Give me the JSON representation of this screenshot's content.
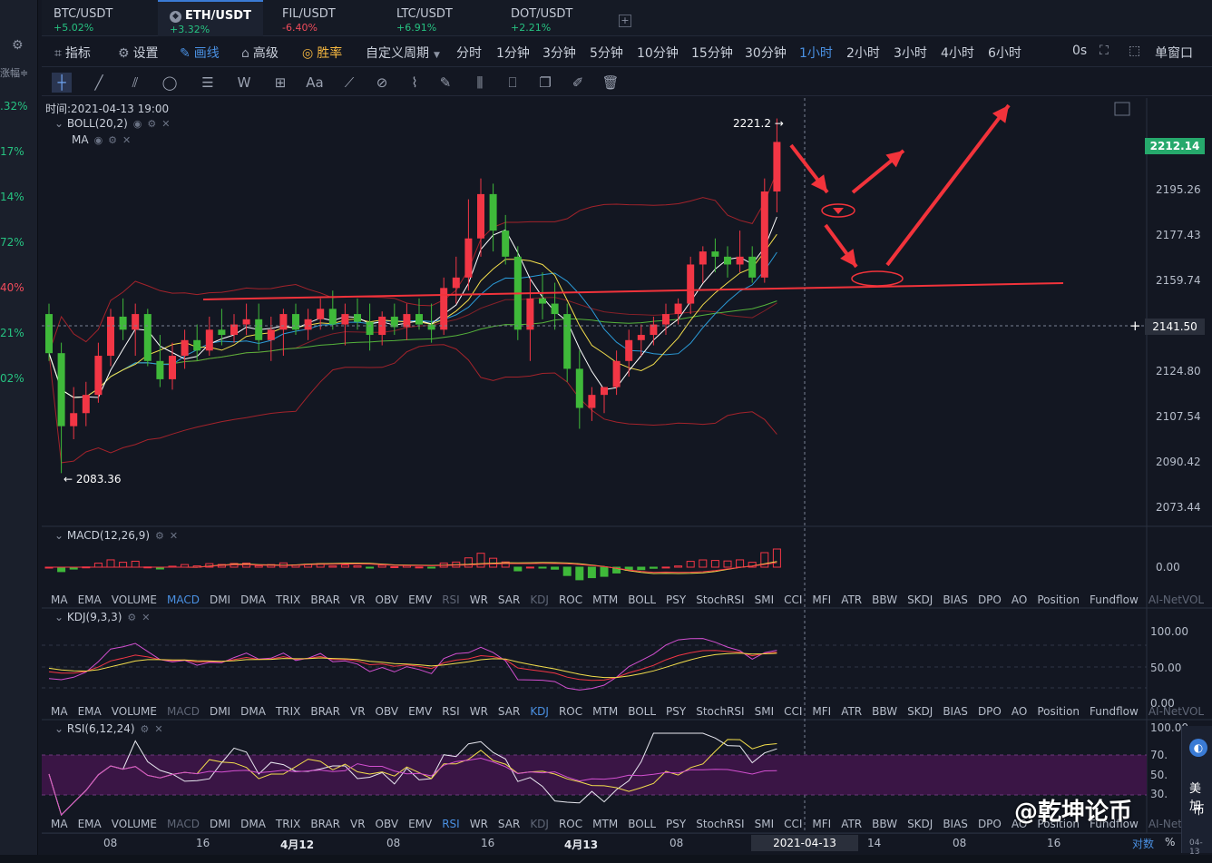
{
  "tabs": [
    {
      "symbol": "BTC/USDT",
      "change": "+5.02%",
      "color": "#26c281"
    },
    {
      "symbol": "ETH/USDT",
      "change": "+3.32%",
      "color": "#26c281"
    },
    {
      "symbol": "FIL/USDT",
      "change": "-6.40%",
      "color": "#f04b5b"
    },
    {
      "symbol": "LTC/USDT",
      "change": "+6.91%",
      "color": "#26c281"
    },
    {
      "symbol": "DOT/USDT",
      "change": "+2.21%",
      "color": "#26c281"
    }
  ],
  "add_tab": "+",
  "left_column": {
    "header": "涨幅≑",
    "items": [
      {
        "text": ".32%",
        "color": "#26c281"
      },
      {
        "text": "17%",
        "color": "#26c281"
      },
      {
        "text": "14%",
        "color": "#26c281"
      },
      {
        "text": "72%",
        "color": "#26c281"
      },
      {
        "text": "40%",
        "color": "#f04b5b"
      },
      {
        "text": "21%",
        "color": "#26c281"
      },
      {
        "text": "02%",
        "color": "#26c281"
      }
    ]
  },
  "toolbar": {
    "indicator": "指标",
    "settings": "设置",
    "draw": "画线",
    "advanced": "高级",
    "winrate": "胜率",
    "custom_period": "自定义周期",
    "periods": [
      "分时",
      "1分钟",
      "3分钟",
      "5分钟",
      "10分钟",
      "15分钟",
      "30分钟",
      "1小时",
      "2小时",
      "3小时",
      "4小时",
      "6小时"
    ],
    "active_period": "1小时",
    "countdown": "0s",
    "single_window": "单窗口"
  },
  "draw_tools": [
    {
      "name": "crosshair",
      "glyph": "┼"
    },
    {
      "name": "trendline",
      "glyph": "╱"
    },
    {
      "name": "parallel-channel",
      "glyph": "⫽"
    },
    {
      "name": "ellipse",
      "glyph": "◯"
    },
    {
      "name": "horizontal-lines",
      "glyph": "☰"
    },
    {
      "name": "wave",
      "glyph": "W"
    },
    {
      "name": "measure",
      "glyph": "⊞"
    },
    {
      "name": "text",
      "glyph": "Aa"
    },
    {
      "name": "brush",
      "glyph": "⟋"
    },
    {
      "name": "eraser",
      "glyph": "⊘"
    },
    {
      "name": "ruler",
      "glyph": "⌇"
    },
    {
      "name": "pencil",
      "glyph": "✎"
    },
    {
      "name": "bar-pattern",
      "glyph": "⫼"
    },
    {
      "name": "lock",
      "glyph": "⎕"
    },
    {
      "name": "copy",
      "glyph": "❐"
    },
    {
      "name": "edit",
      "glyph": "✐"
    },
    {
      "name": "trash",
      "glyph": "🗑"
    }
  ],
  "chart": {
    "time_label": "时间:2021-04-13 19:00",
    "boll_label": "BOLL(20,2)",
    "ma_label": "MA",
    "high_label": "2221.2 →",
    "low_label": "← 2083.36",
    "current_price": "2212.14",
    "cross_price": "2141.50",
    "price_ticks": [
      "2195.26",
      "2177.43",
      "2159.74",
      "2124.80",
      "2107.54",
      "2090.42",
      "2073.44"
    ],
    "macd_label": "MACD(12,26,9)",
    "macd_tick": "0.00",
    "kdj_label": "KDJ(9,3,3)",
    "kdj_ticks": [
      "100.00",
      "50.00",
      "0.00"
    ],
    "rsi_label": "RSI(6,12,24)",
    "rsi_ticks": [
      "100.00",
      "70.",
      "50.",
      "30."
    ],
    "time_ticks": [
      "08",
      "16",
      "4月12",
      "08",
      "16",
      "4月13",
      "08",
      "14",
      "08",
      "16"
    ],
    "cross_time": "2021-04-13 19:00:00",
    "log_label": "对数",
    "pct_label": "%"
  },
  "indicator_list": [
    "MA",
    "EMA",
    "VOLUME",
    "MACD",
    "DMI",
    "DMA",
    "TRIX",
    "BRAR",
    "VR",
    "OBV",
    "EMV",
    "RSI",
    "WR",
    "SAR",
    "KDJ",
    "ROC",
    "MTM",
    "BOLL",
    "PSY",
    "StochRSI",
    "SMI",
    "CCI",
    "MFI",
    "ATR",
    "BBW",
    "SKDJ",
    "BIAS",
    "DPO",
    "AO",
    "Position",
    "Fundflow",
    "AI-NetVOL"
  ],
  "side_popup": {
    "text1": "美加",
    "text2": "币",
    "date": "04-13"
  },
  "watermark": "@乾坤论币",
  "colors": {
    "up": "#f23645",
    "down": "#3fb93a",
    "boll": "#a3232b",
    "ma5": "#ffffff",
    "ma10": "#f3de4c",
    "ma20": "#2b9bd8",
    "ma60": "#55b33b",
    "annot": "#f2333b"
  },
  "chart_data": {
    "type": "candlestick",
    "interval": "1h",
    "candles": [
      [
        2146,
        2150,
        2128,
        2131
      ],
      [
        2131,
        2135,
        2085,
        2103
      ],
      [
        2103,
        2118,
        2098,
        2108
      ],
      [
        2108,
        2120,
        2103,
        2115
      ],
      [
        2115,
        2135,
        2112,
        2130
      ],
      [
        2130,
        2148,
        2126,
        2145
      ],
      [
        2145,
        2152,
        2136,
        2140
      ],
      [
        2140,
        2150,
        2130,
        2146
      ],
      [
        2146,
        2148,
        2126,
        2128
      ],
      [
        2128,
        2138,
        2118,
        2121
      ],
      [
        2121,
        2135,
        2117,
        2130
      ],
      [
        2130,
        2140,
        2125,
        2136
      ],
      [
        2136,
        2142,
        2128,
        2132
      ],
      [
        2132,
        2145,
        2130,
        2140
      ],
      [
        2140,
        2148,
        2134,
        2138
      ],
      [
        2138,
        2146,
        2135,
        2142
      ],
      [
        2142,
        2150,
        2138,
        2144
      ],
      [
        2144,
        2150,
        2132,
        2136
      ],
      [
        2136,
        2145,
        2128,
        2140
      ],
      [
        2140,
        2148,
        2130,
        2146
      ],
      [
        2146,
        2150,
        2138,
        2140
      ],
      [
        2140,
        2148,
        2136,
        2144
      ],
      [
        2144,
        2152,
        2140,
        2148
      ],
      [
        2148,
        2155,
        2140,
        2142
      ],
      [
        2142,
        2150,
        2134,
        2146
      ],
      [
        2146,
        2152,
        2140,
        2143
      ],
      [
        2143,
        2150,
        2132,
        2138
      ],
      [
        2138,
        2147,
        2134,
        2145
      ],
      [
        2145,
        2150,
        2138,
        2141
      ],
      [
        2141,
        2150,
        2136,
        2146
      ],
      [
        2146,
        2152,
        2140,
        2142
      ],
      [
        2142,
        2150,
        2135,
        2140
      ],
      [
        2140,
        2160,
        2138,
        2156
      ],
      [
        2156,
        2168,
        2150,
        2160
      ],
      [
        2160,
        2190,
        2155,
        2175
      ],
      [
        2175,
        2198,
        2168,
        2192
      ],
      [
        2192,
        2196,
        2170,
        2178
      ],
      [
        2178,
        2184,
        2165,
        2168
      ],
      [
        2168,
        2172,
        2136,
        2140
      ],
      [
        2140,
        2160,
        2128,
        2152
      ],
      [
        2152,
        2162,
        2144,
        2150
      ],
      [
        2150,
        2158,
        2140,
        2146
      ],
      [
        2146,
        2150,
        2120,
        2125
      ],
      [
        2125,
        2132,
        2102,
        2110
      ],
      [
        2110,
        2118,
        2105,
        2115
      ],
      [
        2115,
        2118,
        2108,
        2118
      ],
      [
        2118,
        2132,
        2115,
        2128
      ],
      [
        2128,
        2140,
        2122,
        2136
      ],
      [
        2136,
        2142,
        2130,
        2138
      ],
      [
        2138,
        2145,
        2134,
        2142
      ],
      [
        2142,
        2150,
        2138,
        2146
      ],
      [
        2146,
        2152,
        2142,
        2150
      ],
      [
        2150,
        2168,
        2146,
        2165
      ],
      [
        2165,
        2172,
        2158,
        2170
      ],
      [
        2170,
        2175,
        2162,
        2168
      ],
      [
        2168,
        2172,
        2160,
        2165
      ],
      [
        2165,
        2178,
        2162,
        2168
      ],
      [
        2168,
        2172,
        2158,
        2160
      ],
      [
        2160,
        2198,
        2158,
        2193
      ],
      [
        2193,
        2221,
        2185,
        2212
      ]
    ]
  }
}
